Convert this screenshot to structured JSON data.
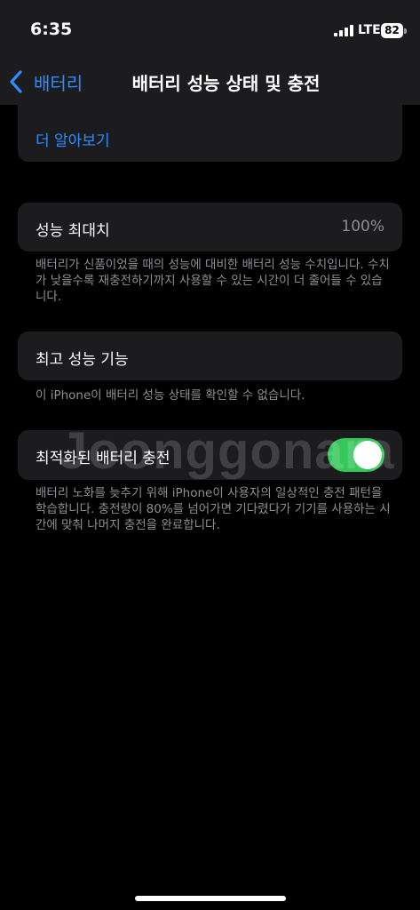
{
  "status_bar": {
    "time": "6:35",
    "network": "LTE",
    "battery_level": "82"
  },
  "nav": {
    "back_label": "배터리",
    "title": "배터리 성능 상태 및 충전"
  },
  "learn_more": {
    "label": "더 알아보기"
  },
  "peak_capacity": {
    "label": "성능 최대치",
    "value": "100%",
    "footnote": "배터리가 신품이었을 때의 성능에 대비한 배터리 성능 수치입니다. 수치가 낮을수록 재충전하기까지 사용할 수 있는 시간이 더 줄어들 수 있습니다."
  },
  "peak_performance": {
    "label": "최고 성능 기능",
    "footnote": "이 iPhone이 배터리 성능 상태를 확인할 수 없습니다."
  },
  "optimized_charging": {
    "label": "최적화된 배터리 충전",
    "enabled": true,
    "footnote": "배터리 노화를 늦추기 위해 iPhone이 사용자의 일상적인 충전 패턴을 학습합니다. 충전량이 80%를 넘어가면 기다렸다가 기기를 사용하는 시간에 맞춰 나머지 충전을 완료합니다."
  },
  "watermark": "Joonggonara",
  "colors": {
    "background": "#000000",
    "card": "#1c1c1e",
    "accent": "#2f8cff",
    "toggle_on": "#34c759",
    "secondary_text": "#8e8e93"
  }
}
